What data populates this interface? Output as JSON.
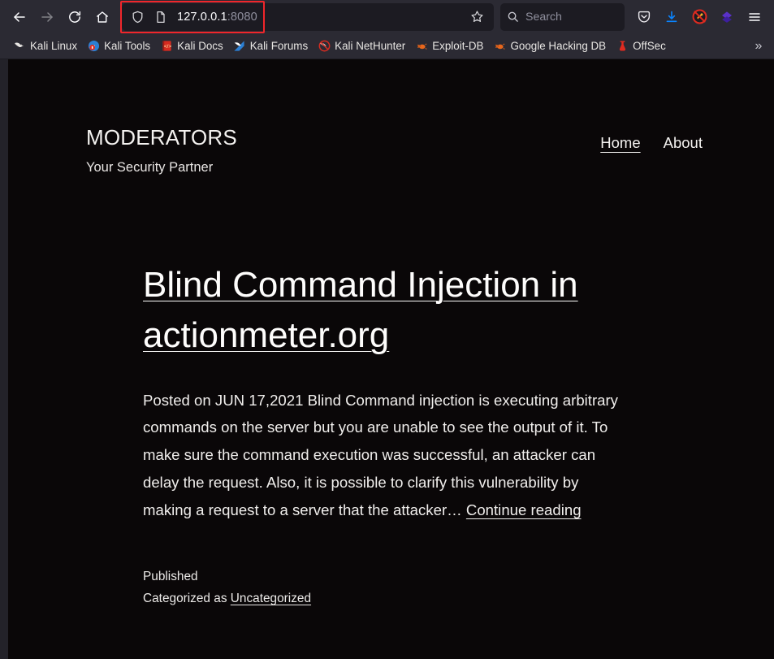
{
  "browser": {
    "nav": {
      "back_icon": "back-arrow-icon",
      "forward_icon": "forward-arrow-icon",
      "reload_icon": "reload-icon",
      "home_icon": "home-icon"
    },
    "urlbar": {
      "shield_icon": "tracking-protection-shield-icon",
      "page_icon": "page-document-icon",
      "host": "127.0.0.1",
      "port": ":8080",
      "bookmark_star_icon": "star-icon",
      "highlight_color": "#f0262b"
    },
    "search": {
      "icon": "search-icon",
      "placeholder": "Search",
      "value": ""
    },
    "actions": [
      {
        "name": "pocket-icon",
        "label": "Pocket"
      },
      {
        "name": "downloads-icon",
        "label": "Downloads"
      },
      {
        "name": "noscript-icon",
        "label": "NoScript"
      },
      {
        "name": "extension-icon",
        "label": "Extension"
      },
      {
        "name": "menu-icon",
        "label": "Open application menu"
      }
    ],
    "bookmarks": [
      {
        "label": "Kali Linux",
        "icon": "kali-dragon-icon"
      },
      {
        "label": "Kali Tools",
        "icon": "kali-tools-icon"
      },
      {
        "label": "Kali Docs",
        "icon": "kali-docs-icon"
      },
      {
        "label": "Kali Forums",
        "icon": "kali-forums-icon"
      },
      {
        "label": "Kali NetHunter",
        "icon": "kali-nethunter-icon"
      },
      {
        "label": "Exploit-DB",
        "icon": "exploit-db-bug-icon"
      },
      {
        "label": "Google Hacking DB",
        "icon": "google-hacking-db-bug-icon"
      },
      {
        "label": "OffSec",
        "icon": "offsec-icon"
      }
    ],
    "bookmarks_overflow": "»"
  },
  "site": {
    "title": "MODERATORS",
    "tagline": "Your Security Partner",
    "nav": [
      {
        "label": "Home",
        "current": true
      },
      {
        "label": "About",
        "current": false
      }
    ]
  },
  "post": {
    "title": "Blind Command Injection in actionmeter.org",
    "excerpt": "Posted on JUN 17,2021 Blind Command injection is executing arbitrary commands on the server but you are unable to see the output of it. To make sure the command execution was successful, an attacker can delay the request. Also, it is possible to clarify this vulnerability by making a request to a server that the attacker…",
    "continue_label": "Continue reading",
    "published_label": "Published",
    "categorized_prefix": "Categorized as ",
    "category": "Uncategorized"
  },
  "colors": {
    "page_background": "#0a0708",
    "chrome_background": "#2b2a33",
    "urlbar_background": "#1c1b22",
    "text": "#f4f2f0",
    "annotation": "#f0262b",
    "download_blue": "#0a84ff",
    "extension_purple": "#5a31c9"
  }
}
